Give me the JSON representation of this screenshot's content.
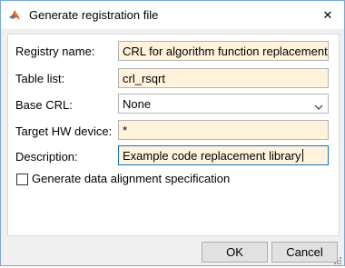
{
  "window": {
    "title": "Generate registration file",
    "close_glyph": "✕",
    "icon": "matlab-logo-icon"
  },
  "form": {
    "registry_name": {
      "label": "Registry name:",
      "value": "CRL for algorithm function replacement"
    },
    "table_list": {
      "label": "Table list:",
      "value": "crl_rsqrt"
    },
    "base_crl": {
      "label": "Base CRL:",
      "value": "None"
    },
    "target_hw": {
      "label": "Target HW device:",
      "value": "*"
    },
    "description": {
      "label": "Description:",
      "value": "Example code replacement library"
    },
    "alignment": {
      "label": "Generate data alignment specification",
      "checked": false
    }
  },
  "buttons": {
    "ok": "OK",
    "cancel": "Cancel"
  },
  "colors": {
    "field_bg": "#fff3dc",
    "focus_border": "#1473c6",
    "window_border": "#7aa7d6"
  }
}
